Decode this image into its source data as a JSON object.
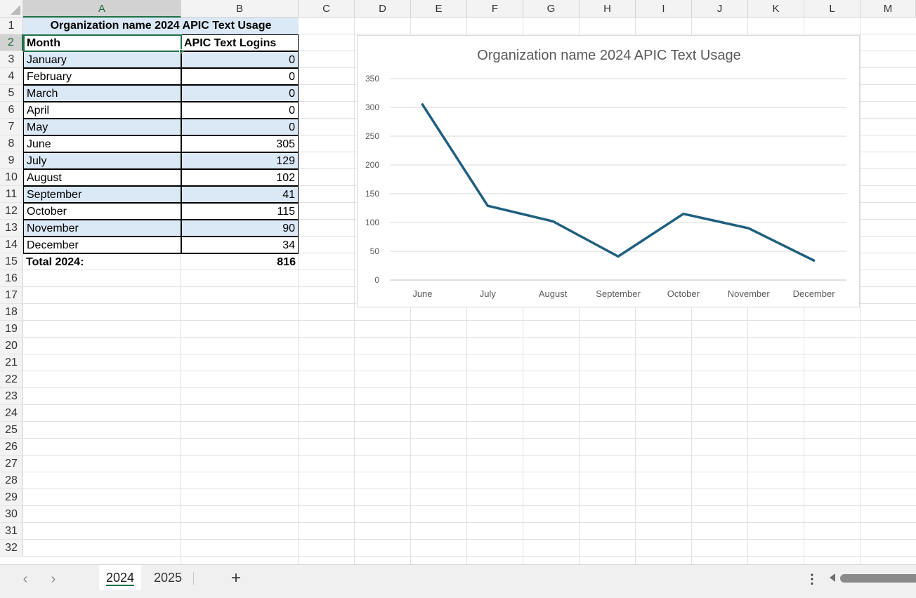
{
  "columns": [
    "A",
    "B",
    "C",
    "D",
    "E",
    "F",
    "G",
    "H",
    "I",
    "J",
    "K",
    "L",
    "M"
  ],
  "rows": [
    "1",
    "2",
    "3",
    "4",
    "5",
    "6",
    "7",
    "8",
    "9",
    "10",
    "11",
    "12",
    "13",
    "14",
    "15",
    "16",
    "17",
    "18",
    "19",
    "20",
    "21",
    "22",
    "23",
    "24",
    "25",
    "26",
    "27",
    "28",
    "29",
    "30",
    "31",
    "32"
  ],
  "table": {
    "title": "Organization name 2024 APIC Text Usage",
    "header_month": "Month",
    "header_logins": "APIC Text Logins",
    "rows": [
      {
        "month": "January",
        "logins": "0"
      },
      {
        "month": "February",
        "logins": "0"
      },
      {
        "month": "March",
        "logins": "0"
      },
      {
        "month": "April",
        "logins": "0"
      },
      {
        "month": "May",
        "logins": "0"
      },
      {
        "month": "June",
        "logins": "305"
      },
      {
        "month": "July",
        "logins": "129"
      },
      {
        "month": "August",
        "logins": "102"
      },
      {
        "month": "September",
        "logins": "41"
      },
      {
        "month": "October",
        "logins": "115"
      },
      {
        "month": "November",
        "logins": "90"
      },
      {
        "month": "December",
        "logins": "34"
      }
    ],
    "total_label": "Total 2024:",
    "total_value": "816"
  },
  "chart_data": {
    "type": "line",
    "title": "Organization name 2024 APIC Text Usage",
    "categories": [
      "June",
      "July",
      "August",
      "September",
      "October",
      "November",
      "December"
    ],
    "series": [
      {
        "values": [
          305,
          129,
          102,
          41,
          115,
          90,
          34
        ],
        "color": "#1f5f7f"
      }
    ],
    "ylim": [
      0,
      350
    ],
    "yticks": [
      "0",
      "50",
      "100",
      "150",
      "200",
      "250",
      "300",
      "350"
    ],
    "grid": true,
    "legend": "none"
  },
  "tabs": {
    "prev_icon": "chevron-left-icon",
    "next_icon": "chevron-right-icon",
    "sheets": [
      {
        "label": "2024",
        "active": true
      },
      {
        "label": "2025",
        "active": false
      }
    ],
    "add_label": "+",
    "more_label": "⋮"
  }
}
